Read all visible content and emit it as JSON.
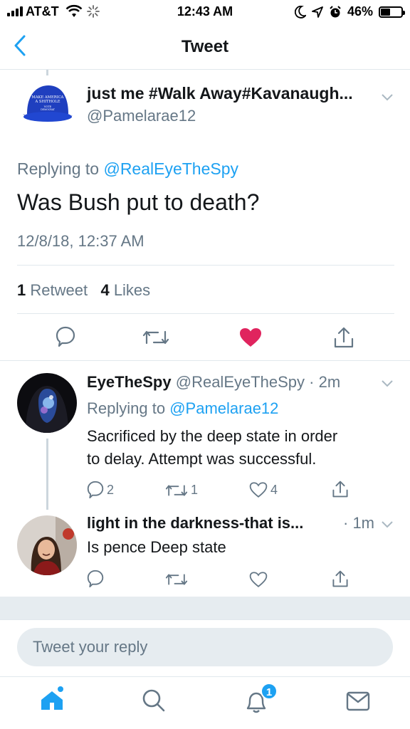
{
  "status_bar": {
    "carrier": "AT&T",
    "time": "12:43 AM",
    "battery": "46%"
  },
  "header": {
    "title": "Tweet"
  },
  "main_tweet": {
    "name": "just me #Walk Away#Kavanaugh...",
    "handle": "@Pamelarae12",
    "replying_prefix": "Replying to",
    "replying_to": "@RealEyeTheSpy",
    "text": "Was Bush put to death?",
    "timestamp": "12/8/18, 12:37 AM",
    "avatar_hat_text": "MAKE AMERICA A SHITHOLE VOTE DEMOCRAT",
    "stats": {
      "retweets_count": "1",
      "retweets_label": "Retweet",
      "likes_count": "4",
      "likes_label": "Likes"
    }
  },
  "replies": [
    {
      "name": "EyeTheSpy",
      "handle": "@RealEyeTheSpy",
      "time": "· 2m",
      "replying_prefix": "Replying to",
      "replying_to": "@Pamelarae12",
      "text_line1": "Sacrificed by the deep state in order",
      "text_line2": "to delay. Attempt was successful.",
      "reply_count": "2",
      "retweet_count": "1",
      "like_count": "4"
    },
    {
      "name": "light in the darkness-that is...",
      "time": "· 1m",
      "text": "Is pence Deep state"
    }
  ],
  "compose": {
    "placeholder": "Tweet your reply"
  },
  "tabbar": {
    "notifications_badge": "1"
  },
  "colors": {
    "accent": "#1da1f2",
    "like": "#e0245e",
    "secondary_text": "#657786"
  }
}
